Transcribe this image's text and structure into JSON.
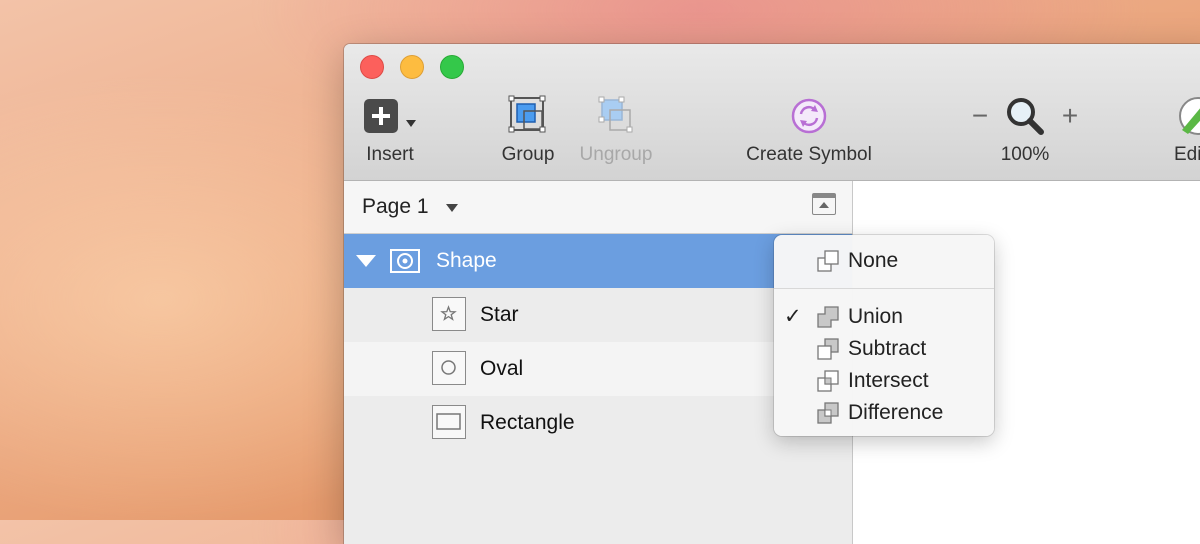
{
  "toolbar": {
    "insert_label": "Insert",
    "group_label": "Group",
    "ungroup_label": "Ungroup",
    "create_symbol_label": "Create Symbol",
    "zoom_minus": "−",
    "zoom_plus": "+",
    "zoom_level": "100%",
    "edit_label": "Edit"
  },
  "pages": {
    "current": "Page 1"
  },
  "layers": {
    "group": {
      "name": "Shape"
    },
    "children": [
      {
        "name": "Star",
        "icon": "star-icon"
      },
      {
        "name": "Oval",
        "icon": "oval-icon"
      },
      {
        "name": "Rectangle",
        "icon": "rectangle-icon"
      }
    ]
  },
  "boolean_menu": {
    "checkmark": "✓",
    "items": [
      {
        "label": "None",
        "checked": false
      },
      {
        "label": "Union",
        "checked": true
      },
      {
        "label": "Subtract",
        "checked": false
      },
      {
        "label": "Intersect",
        "checked": false
      },
      {
        "label": "Difference",
        "checked": false
      }
    ]
  },
  "colors": {
    "selection": "#6b9ee0",
    "create_symbol_accent": "#b86fd4",
    "edit_accent": "#5bb845"
  }
}
